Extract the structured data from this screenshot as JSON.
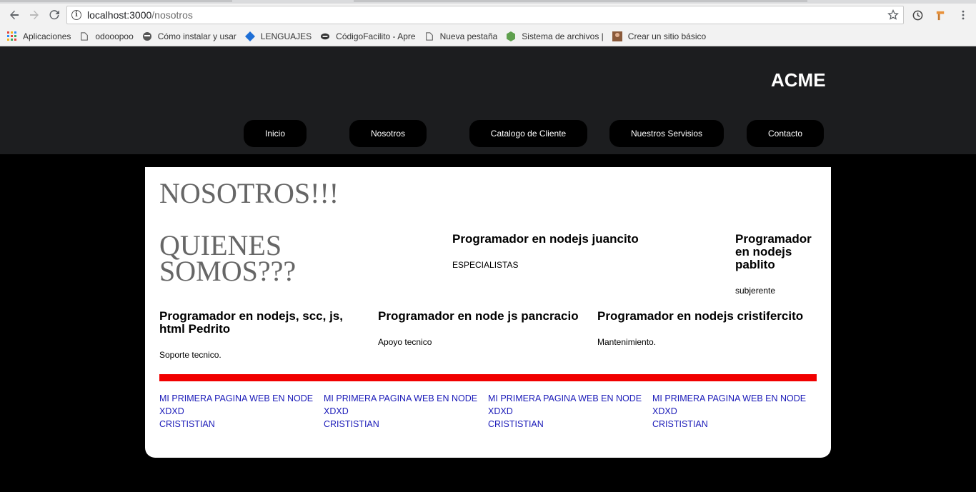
{
  "browser": {
    "url_host": "localhost:3000",
    "url_path": "/nosotros",
    "bookmarks": [
      {
        "label": "Aplicaciones",
        "icon": "apps-grid-icon"
      },
      {
        "label": "odooopoo",
        "icon": "page-icon"
      },
      {
        "label": "Cómo instalar y usar",
        "icon": "site-icon"
      },
      {
        "label": "LENGUAJES",
        "icon": "diamond-icon"
      },
      {
        "label": "CódigoFacilito - Apre",
        "icon": "pro-icon"
      },
      {
        "label": "Nueva pestaña",
        "icon": "page-icon"
      },
      {
        "label": "Sistema de archivos |",
        "icon": "node-icon"
      },
      {
        "label": "Crear un sitio básico",
        "icon": "avatar-icon"
      }
    ]
  },
  "site": {
    "brand": "ACME",
    "menu": [
      "Inicio",
      "Nosotros",
      "Catalogo de Cliente",
      "Nuestros Servisios",
      "Contacto"
    ]
  },
  "content": {
    "title": "NOSOTROS!!!",
    "subtitle": "QUIENES SOMOS???",
    "cards": [
      {
        "title": "Programador en nodejs juancito",
        "text": "ESPECIALISTAS"
      },
      {
        "title": "Programador en nodejs pablito",
        "text": "subjerente"
      },
      {
        "title": "Programador en nodejs, scc, js, html Pedrito",
        "text": "Soporte tecnico."
      },
      {
        "title": "Programador en node js pancracio",
        "text": "Apoyo tecnico"
      },
      {
        "title": "Programador en nodejs cristifercito",
        "text": "Mantenimiento."
      }
    ],
    "footer": [
      {
        "line1": "MI PRIMERA PAGINA WEB EN NODE",
        "line2": "XDXD",
        "line3": "CRISTISTIAN"
      },
      {
        "line1": "MI PRIMERA PAGINA WEB EN NODE",
        "line2": "XDXD",
        "line3": "CRISTISTIAN"
      },
      {
        "line1": "MI PRIMERA PAGINA WEB EN NODE",
        "line2": "XDXD",
        "line3": "CRISTISTIAN"
      },
      {
        "line1": "MI PRIMERA PAGINA WEB EN NODE",
        "line2": "XDXD",
        "line3": "CRISTISTIAN"
      }
    ]
  },
  "colors": {
    "header_bg": "#1c1d1f",
    "accent_bar": "#f10000",
    "link": "#1a1ab8"
  }
}
